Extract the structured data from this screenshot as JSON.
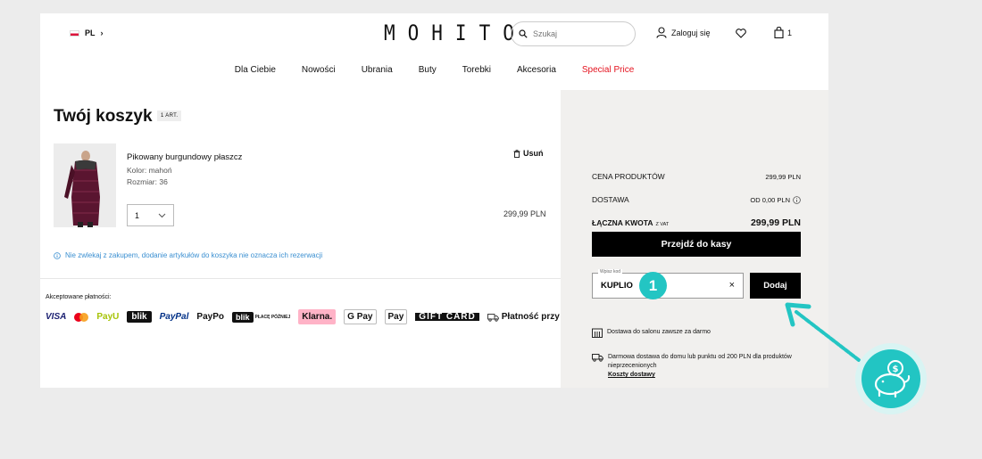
{
  "header": {
    "lang": "PL",
    "logo": "MOHITO",
    "search_placeholder": "Szukaj",
    "login": "Zaloguj się",
    "cart_count": "1"
  },
  "nav": [
    {
      "label": "Dla Ciebie"
    },
    {
      "label": "Nowości"
    },
    {
      "label": "Ubrania"
    },
    {
      "label": "Buty"
    },
    {
      "label": "Torebki"
    },
    {
      "label": "Akcesoria"
    },
    {
      "label": "Special Price"
    }
  ],
  "cart": {
    "title": "Twój koszyk",
    "count_badge": "1 ART.",
    "product": {
      "name": "Pikowany burgundowy płaszcz",
      "color": "Kolor: mahoń",
      "size": "Rozmiar: 36",
      "qty": "1",
      "price": "299,99 PLN",
      "remove": "Usuń"
    },
    "info": "Nie zwlekaj z zakupem, dodanie artykułów do koszyka nie oznacza ich rezerwacji"
  },
  "payments": {
    "label": "Akceptowane płatności:",
    "methods": [
      "VISA",
      "PayU",
      "blik",
      "PayPal",
      "PayPo",
      "blik",
      "PŁACĘ PÓŹNIEJ",
      "Klarna.",
      "G Pay",
      "Pay",
      "GIFT CARD",
      "Płatność przy odbiorze"
    ]
  },
  "summary": {
    "products_label": "CENA PRODUKTÓW",
    "products_value": "299,99 PLN",
    "delivery_label": "DOSTAWA",
    "delivery_value": "OD 0,00 PLN",
    "total_label": "ŁĄCZNA KWOTA",
    "total_vat": "Z VAT",
    "total_value": "299,99 PLN",
    "checkout": "Przejdź do kasy",
    "code_label": "Wpisz kod",
    "code_value": "KUPLIO",
    "add": "Dodaj",
    "info1": "Dostawa do salonu zawsze za darmo",
    "info2": "Darmowa dostawa do domu lub punktu od 200 PLN dla produktów nieprzecenionych",
    "info2_link": "Koszty dostawy"
  },
  "overlay": {
    "step": "1",
    "accent": "#23c5c3"
  }
}
